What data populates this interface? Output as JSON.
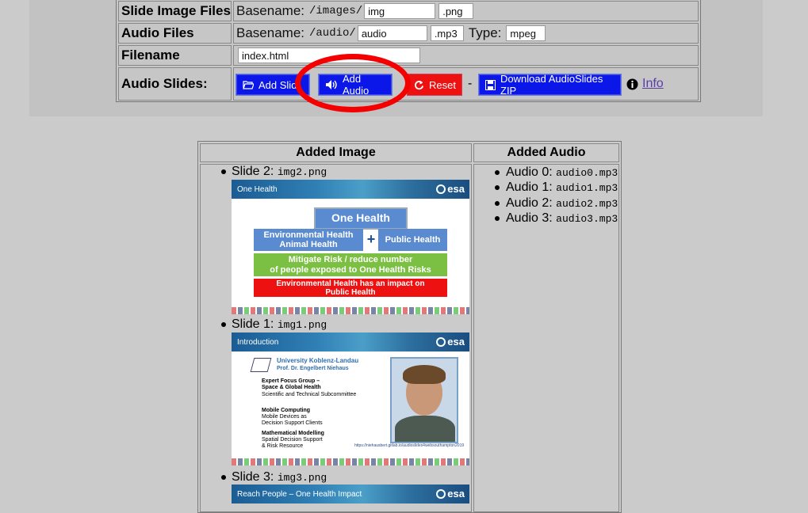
{
  "config": {
    "slide_image_files": {
      "label": "Slide Image Files",
      "prefix": "Basename:",
      "path": "/images/",
      "basename": "img",
      "ext": ".png"
    },
    "audio_files": {
      "label": "Audio Files",
      "prefix": "Basename:",
      "path": "/audio/",
      "basename": "audio",
      "ext": ".mp3",
      "type_label": "Type:",
      "type_value": "mpeg"
    },
    "filename": {
      "label": "Filename",
      "value": "index.html"
    },
    "audio_slides": {
      "label": "Audio Slides:",
      "add_slide": "Add Slid",
      "add_audio": "Add Audio",
      "reset": "Reset",
      "separator": "-",
      "download": "Download AudioSlides ZIP",
      "info": "Info"
    }
  },
  "table": {
    "header_image": "Added Image",
    "header_audio": "Added Audio",
    "slides": [
      {
        "label": "Slide 2:",
        "file": "img2.png"
      },
      {
        "label": "Slide 1:",
        "file": "img1.png"
      },
      {
        "label": "Slide 3:",
        "file": "img3.png"
      }
    ],
    "audios": [
      {
        "label": "Audio 0:",
        "file": "audio0.mp3"
      },
      {
        "label": "Audio 1:",
        "file": "audio1.mp3"
      },
      {
        "label": "Audio 2:",
        "file": "audio2.mp3"
      },
      {
        "label": "Audio 3:",
        "file": "audio3.mp3"
      }
    ]
  },
  "slide_previews": {
    "s2": {
      "banner": "One Health",
      "logo": "esa",
      "title": "One Health",
      "box_env": "Environmental Health\nAnimal Health",
      "plus": "+",
      "box_public": "Public Health",
      "box_mitigate": "Mitigate Risk / reduce number\nof people exposed to One Health Risks",
      "box_impact": "Environmental Health has an impact on\nPublic Health"
    },
    "s1": {
      "banner": "Introduction",
      "logo": "esa",
      "univ": "University Koblenz-Landau",
      "prof": "Prof. Dr. Engelbert Niehaus",
      "g1_title": "Expert Focus Group –\nSpace & Global Health",
      "g1_sub": "Scientific and Technical Subcommittee",
      "g2_title": "Mobile Computing",
      "g2_sub": "Mobile Devices as\nDecision Support Clients",
      "g3_title": "Mathematical Modelling",
      "g3_sub": "Spatial Decision Support\n& Risk Resource",
      "url": "https://niehausbert.gitlab.io/audioslides4websouthampton2019"
    },
    "s3": {
      "banner": "Reach People – One Health Impact",
      "logo": "esa"
    }
  },
  "colors": {
    "button_blue": "#0a17e8",
    "button_red": "#ee1111",
    "highlight": "#f40000",
    "box_blue": "#5a8bd0",
    "box_green": "#7cc043",
    "box_red": "#e11"
  }
}
